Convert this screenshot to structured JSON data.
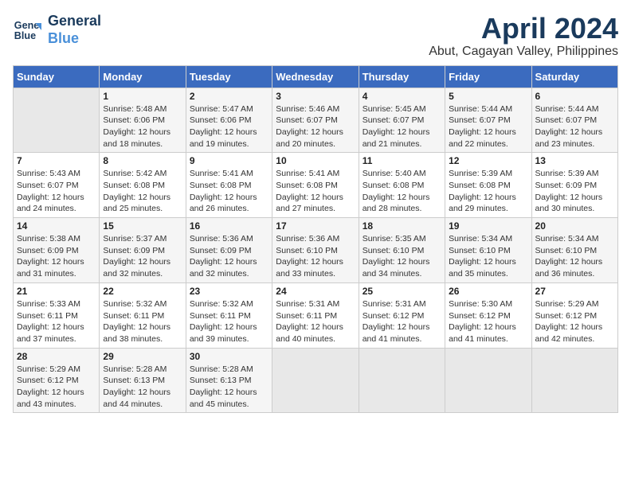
{
  "logo": {
    "line1": "General",
    "line2": "Blue"
  },
  "title": "April 2024",
  "subtitle": "Abut, Cagayan Valley, Philippines",
  "days_of_week": [
    "Sunday",
    "Monday",
    "Tuesday",
    "Wednesday",
    "Thursday",
    "Friday",
    "Saturday"
  ],
  "weeks": [
    [
      {
        "day": "",
        "info": ""
      },
      {
        "day": "1",
        "info": "Sunrise: 5:48 AM\nSunset: 6:06 PM\nDaylight: 12 hours\nand 18 minutes."
      },
      {
        "day": "2",
        "info": "Sunrise: 5:47 AM\nSunset: 6:06 PM\nDaylight: 12 hours\nand 19 minutes."
      },
      {
        "day": "3",
        "info": "Sunrise: 5:46 AM\nSunset: 6:07 PM\nDaylight: 12 hours\nand 20 minutes."
      },
      {
        "day": "4",
        "info": "Sunrise: 5:45 AM\nSunset: 6:07 PM\nDaylight: 12 hours\nand 21 minutes."
      },
      {
        "day": "5",
        "info": "Sunrise: 5:44 AM\nSunset: 6:07 PM\nDaylight: 12 hours\nand 22 minutes."
      },
      {
        "day": "6",
        "info": "Sunrise: 5:44 AM\nSunset: 6:07 PM\nDaylight: 12 hours\nand 23 minutes."
      }
    ],
    [
      {
        "day": "7",
        "info": "Sunrise: 5:43 AM\nSunset: 6:07 PM\nDaylight: 12 hours\nand 24 minutes."
      },
      {
        "day": "8",
        "info": "Sunrise: 5:42 AM\nSunset: 6:08 PM\nDaylight: 12 hours\nand 25 minutes."
      },
      {
        "day": "9",
        "info": "Sunrise: 5:41 AM\nSunset: 6:08 PM\nDaylight: 12 hours\nand 26 minutes."
      },
      {
        "day": "10",
        "info": "Sunrise: 5:41 AM\nSunset: 6:08 PM\nDaylight: 12 hours\nand 27 minutes."
      },
      {
        "day": "11",
        "info": "Sunrise: 5:40 AM\nSunset: 6:08 PM\nDaylight: 12 hours\nand 28 minutes."
      },
      {
        "day": "12",
        "info": "Sunrise: 5:39 AM\nSunset: 6:08 PM\nDaylight: 12 hours\nand 29 minutes."
      },
      {
        "day": "13",
        "info": "Sunrise: 5:39 AM\nSunset: 6:09 PM\nDaylight: 12 hours\nand 30 minutes."
      }
    ],
    [
      {
        "day": "14",
        "info": "Sunrise: 5:38 AM\nSunset: 6:09 PM\nDaylight: 12 hours\nand 31 minutes."
      },
      {
        "day": "15",
        "info": "Sunrise: 5:37 AM\nSunset: 6:09 PM\nDaylight: 12 hours\nand 32 minutes."
      },
      {
        "day": "16",
        "info": "Sunrise: 5:36 AM\nSunset: 6:09 PM\nDaylight: 12 hours\nand 32 minutes."
      },
      {
        "day": "17",
        "info": "Sunrise: 5:36 AM\nSunset: 6:10 PM\nDaylight: 12 hours\nand 33 minutes."
      },
      {
        "day": "18",
        "info": "Sunrise: 5:35 AM\nSunset: 6:10 PM\nDaylight: 12 hours\nand 34 minutes."
      },
      {
        "day": "19",
        "info": "Sunrise: 5:34 AM\nSunset: 6:10 PM\nDaylight: 12 hours\nand 35 minutes."
      },
      {
        "day": "20",
        "info": "Sunrise: 5:34 AM\nSunset: 6:10 PM\nDaylight: 12 hours\nand 36 minutes."
      }
    ],
    [
      {
        "day": "21",
        "info": "Sunrise: 5:33 AM\nSunset: 6:11 PM\nDaylight: 12 hours\nand 37 minutes."
      },
      {
        "day": "22",
        "info": "Sunrise: 5:32 AM\nSunset: 6:11 PM\nDaylight: 12 hours\nand 38 minutes."
      },
      {
        "day": "23",
        "info": "Sunrise: 5:32 AM\nSunset: 6:11 PM\nDaylight: 12 hours\nand 39 minutes."
      },
      {
        "day": "24",
        "info": "Sunrise: 5:31 AM\nSunset: 6:11 PM\nDaylight: 12 hours\nand 40 minutes."
      },
      {
        "day": "25",
        "info": "Sunrise: 5:31 AM\nSunset: 6:12 PM\nDaylight: 12 hours\nand 41 minutes."
      },
      {
        "day": "26",
        "info": "Sunrise: 5:30 AM\nSunset: 6:12 PM\nDaylight: 12 hours\nand 41 minutes."
      },
      {
        "day": "27",
        "info": "Sunrise: 5:29 AM\nSunset: 6:12 PM\nDaylight: 12 hours\nand 42 minutes."
      }
    ],
    [
      {
        "day": "28",
        "info": "Sunrise: 5:29 AM\nSunset: 6:12 PM\nDaylight: 12 hours\nand 43 minutes."
      },
      {
        "day": "29",
        "info": "Sunrise: 5:28 AM\nSunset: 6:13 PM\nDaylight: 12 hours\nand 44 minutes."
      },
      {
        "day": "30",
        "info": "Sunrise: 5:28 AM\nSunset: 6:13 PM\nDaylight: 12 hours\nand 45 minutes."
      },
      {
        "day": "",
        "info": ""
      },
      {
        "day": "",
        "info": ""
      },
      {
        "day": "",
        "info": ""
      },
      {
        "day": "",
        "info": ""
      }
    ]
  ]
}
